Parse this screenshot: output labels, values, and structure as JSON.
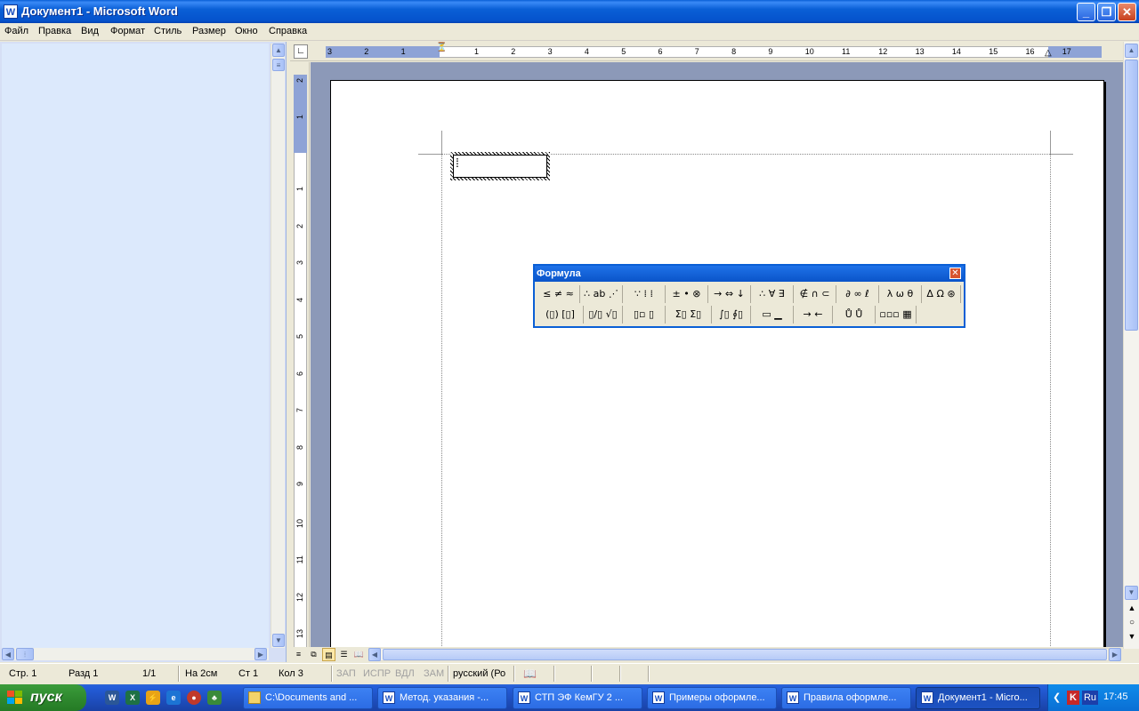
{
  "window": {
    "title": "Документ1 - Microsoft Word"
  },
  "menu": [
    "Файл",
    "Правка",
    "Вид",
    "Формат",
    "Стиль",
    "Размер",
    "Окно",
    "Справка"
  ],
  "ruler": {
    "h_left_numbers": [
      "3",
      "2",
      "1"
    ],
    "h_numbers": [
      "1",
      "2",
      "3",
      "4",
      "5",
      "6",
      "7",
      "8",
      "9",
      "10",
      "11",
      "12",
      "13",
      "14",
      "15",
      "16",
      "17"
    ],
    "v_top_numbers": [
      "2",
      "1"
    ],
    "v_numbers": [
      "1",
      "2",
      "3",
      "4",
      "5",
      "6",
      "7",
      "8",
      "9",
      "10",
      "11",
      "12",
      "13"
    ]
  },
  "formula_toolbar": {
    "title": "Формула",
    "row1": [
      "≤ ≠ ≈",
      "∴ ab ⋰",
      "∵ ⁞ ⁞",
      "± • ⊗",
      "→ ⇔ ↓",
      "∴ ∀ ∃",
      "∉ ∩ ⊂",
      "∂ ∞ ℓ",
      "λ ω θ",
      "Δ Ω ⊛"
    ],
    "row2": [
      "(▯) [▯]",
      "▯/▯ √▯",
      "▯▫ ▯",
      "Σ▯ Σ▯",
      "∫▯ ∮▯",
      "▭ ▁",
      "→ ←",
      "Ů Ů",
      "▫▫▫ ▦"
    ]
  },
  "statusbar": {
    "page": "Стр. 1",
    "section": "Разд 1",
    "pages": "1/1",
    "at": "На 2см",
    "line": "Ст 1",
    "col": "Кол 3",
    "rec": "ЗАП",
    "trk": "ИСПР",
    "ext": "ВДЛ",
    "ovr": "ЗАМ",
    "language": "русский (Ро"
  },
  "taskbar": {
    "start": "пуск",
    "tasks": [
      {
        "label": "C:\\Documents and ...",
        "icon": "folder"
      },
      {
        "label": "Метод. указания -...",
        "icon": "word"
      },
      {
        "label": "СТП ЭФ КемГУ  2 ...",
        "icon": "word"
      },
      {
        "label": "Примеры оформле...",
        "icon": "word"
      },
      {
        "label": "Правила оформле...",
        "icon": "word"
      },
      {
        "label": "Документ1 - Micro...",
        "icon": "word",
        "active": true
      }
    ],
    "tray": {
      "lang": "Ru",
      "time": "17:45"
    }
  }
}
